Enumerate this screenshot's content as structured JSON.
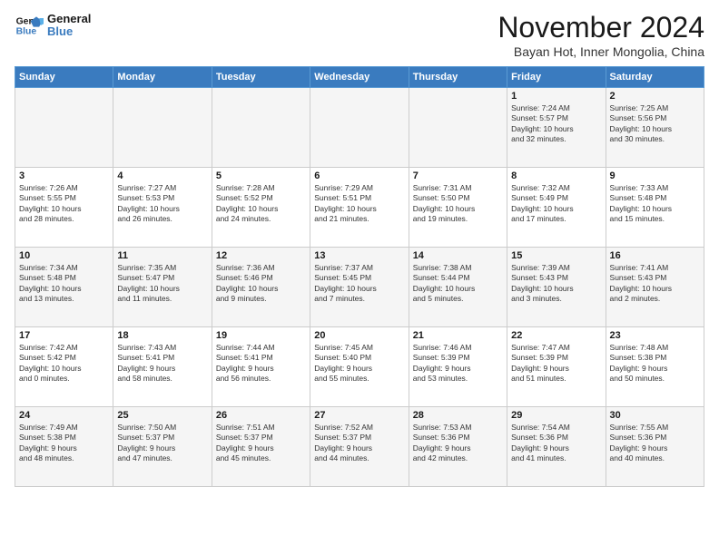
{
  "logo": {
    "line1": "General",
    "line2": "Blue"
  },
  "title": "November 2024",
  "subtitle": "Bayan Hot, Inner Mongolia, China",
  "headers": [
    "Sunday",
    "Monday",
    "Tuesday",
    "Wednesday",
    "Thursday",
    "Friday",
    "Saturday"
  ],
  "rows": [
    [
      {
        "day": "",
        "info": ""
      },
      {
        "day": "",
        "info": ""
      },
      {
        "day": "",
        "info": ""
      },
      {
        "day": "",
        "info": ""
      },
      {
        "day": "",
        "info": ""
      },
      {
        "day": "1",
        "info": "Sunrise: 7:24 AM\nSunset: 5:57 PM\nDaylight: 10 hours\nand 32 minutes."
      },
      {
        "day": "2",
        "info": "Sunrise: 7:25 AM\nSunset: 5:56 PM\nDaylight: 10 hours\nand 30 minutes."
      }
    ],
    [
      {
        "day": "3",
        "info": "Sunrise: 7:26 AM\nSunset: 5:55 PM\nDaylight: 10 hours\nand 28 minutes."
      },
      {
        "day": "4",
        "info": "Sunrise: 7:27 AM\nSunset: 5:53 PM\nDaylight: 10 hours\nand 26 minutes."
      },
      {
        "day": "5",
        "info": "Sunrise: 7:28 AM\nSunset: 5:52 PM\nDaylight: 10 hours\nand 24 minutes."
      },
      {
        "day": "6",
        "info": "Sunrise: 7:29 AM\nSunset: 5:51 PM\nDaylight: 10 hours\nand 21 minutes."
      },
      {
        "day": "7",
        "info": "Sunrise: 7:31 AM\nSunset: 5:50 PM\nDaylight: 10 hours\nand 19 minutes."
      },
      {
        "day": "8",
        "info": "Sunrise: 7:32 AM\nSunset: 5:49 PM\nDaylight: 10 hours\nand 17 minutes."
      },
      {
        "day": "9",
        "info": "Sunrise: 7:33 AM\nSunset: 5:48 PM\nDaylight: 10 hours\nand 15 minutes."
      }
    ],
    [
      {
        "day": "10",
        "info": "Sunrise: 7:34 AM\nSunset: 5:48 PM\nDaylight: 10 hours\nand 13 minutes."
      },
      {
        "day": "11",
        "info": "Sunrise: 7:35 AM\nSunset: 5:47 PM\nDaylight: 10 hours\nand 11 minutes."
      },
      {
        "day": "12",
        "info": "Sunrise: 7:36 AM\nSunset: 5:46 PM\nDaylight: 10 hours\nand 9 minutes."
      },
      {
        "day": "13",
        "info": "Sunrise: 7:37 AM\nSunset: 5:45 PM\nDaylight: 10 hours\nand 7 minutes."
      },
      {
        "day": "14",
        "info": "Sunrise: 7:38 AM\nSunset: 5:44 PM\nDaylight: 10 hours\nand 5 minutes."
      },
      {
        "day": "15",
        "info": "Sunrise: 7:39 AM\nSunset: 5:43 PM\nDaylight: 10 hours\nand 3 minutes."
      },
      {
        "day": "16",
        "info": "Sunrise: 7:41 AM\nSunset: 5:43 PM\nDaylight: 10 hours\nand 2 minutes."
      }
    ],
    [
      {
        "day": "17",
        "info": "Sunrise: 7:42 AM\nSunset: 5:42 PM\nDaylight: 10 hours\nand 0 minutes."
      },
      {
        "day": "18",
        "info": "Sunrise: 7:43 AM\nSunset: 5:41 PM\nDaylight: 9 hours\nand 58 minutes."
      },
      {
        "day": "19",
        "info": "Sunrise: 7:44 AM\nSunset: 5:41 PM\nDaylight: 9 hours\nand 56 minutes."
      },
      {
        "day": "20",
        "info": "Sunrise: 7:45 AM\nSunset: 5:40 PM\nDaylight: 9 hours\nand 55 minutes."
      },
      {
        "day": "21",
        "info": "Sunrise: 7:46 AM\nSunset: 5:39 PM\nDaylight: 9 hours\nand 53 minutes."
      },
      {
        "day": "22",
        "info": "Sunrise: 7:47 AM\nSunset: 5:39 PM\nDaylight: 9 hours\nand 51 minutes."
      },
      {
        "day": "23",
        "info": "Sunrise: 7:48 AM\nSunset: 5:38 PM\nDaylight: 9 hours\nand 50 minutes."
      }
    ],
    [
      {
        "day": "24",
        "info": "Sunrise: 7:49 AM\nSunset: 5:38 PM\nDaylight: 9 hours\nand 48 minutes."
      },
      {
        "day": "25",
        "info": "Sunrise: 7:50 AM\nSunset: 5:37 PM\nDaylight: 9 hours\nand 47 minutes."
      },
      {
        "day": "26",
        "info": "Sunrise: 7:51 AM\nSunset: 5:37 PM\nDaylight: 9 hours\nand 45 minutes."
      },
      {
        "day": "27",
        "info": "Sunrise: 7:52 AM\nSunset: 5:37 PM\nDaylight: 9 hours\nand 44 minutes."
      },
      {
        "day": "28",
        "info": "Sunrise: 7:53 AM\nSunset: 5:36 PM\nDaylight: 9 hours\nand 42 minutes."
      },
      {
        "day": "29",
        "info": "Sunrise: 7:54 AM\nSunset: 5:36 PM\nDaylight: 9 hours\nand 41 minutes."
      },
      {
        "day": "30",
        "info": "Sunrise: 7:55 AM\nSunset: 5:36 PM\nDaylight: 9 hours\nand 40 minutes."
      }
    ]
  ]
}
